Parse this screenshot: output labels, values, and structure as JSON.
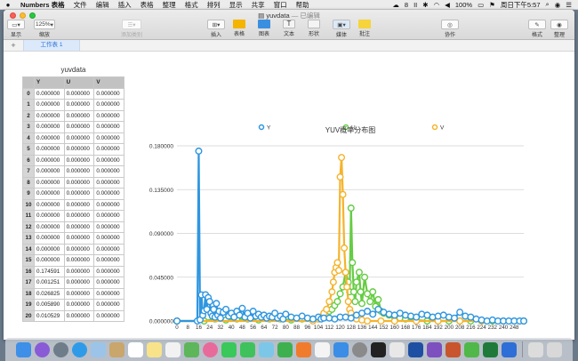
{
  "menubar": {
    "app_name": "Numbers 表格",
    "items": [
      "文件",
      "编辑",
      "插入",
      "表格",
      "整理",
      "格式",
      "排列",
      "显示",
      "共享",
      "窗口",
      "帮助"
    ],
    "status": {
      "battery": "100%",
      "datetime": "周日下午5:57",
      "badge": "8",
      "pause": "II"
    }
  },
  "window": {
    "title": "yuvdata",
    "edited": "— 已编辑"
  },
  "toolbar": {
    "view_label": "显示",
    "zoom_value": "125%",
    "zoom_label": "缩放",
    "add_category_label": "添加类别",
    "insert_label": "插入",
    "table_label": "表格",
    "chart_label": "图表",
    "text_label": "文本",
    "shape_label": "形状",
    "media_label": "媒体",
    "comment_label": "批注",
    "collaborate_label": "协作",
    "format_label": "格式",
    "organize_label": "整理"
  },
  "sheet_tabs": {
    "add": "+",
    "active": "工作表 1"
  },
  "table": {
    "title": "yuvdata",
    "headers": [
      "Y",
      "U",
      "V"
    ],
    "rows": [
      {
        "idx": "0",
        "y": "0.000000",
        "u": "0.000000",
        "v": "0.000000"
      },
      {
        "idx": "1",
        "y": "0.000000",
        "u": "0.000000",
        "v": "0.000000"
      },
      {
        "idx": "2",
        "y": "0.000000",
        "u": "0.000000",
        "v": "0.000000"
      },
      {
        "idx": "3",
        "y": "0.000000",
        "u": "0.000000",
        "v": "0.000000"
      },
      {
        "idx": "4",
        "y": "0.000000",
        "u": "0.000000",
        "v": "0.000000"
      },
      {
        "idx": "5",
        "y": "0.000000",
        "u": "0.000000",
        "v": "0.000000"
      },
      {
        "idx": "6",
        "y": "0.000000",
        "u": "0.000000",
        "v": "0.000000"
      },
      {
        "idx": "7",
        "y": "0.000000",
        "u": "0.000000",
        "v": "0.000000"
      },
      {
        "idx": "8",
        "y": "0.000000",
        "u": "0.000000",
        "v": "0.000000"
      },
      {
        "idx": "9",
        "y": "0.000000",
        "u": "0.000000",
        "v": "0.000000"
      },
      {
        "idx": "10",
        "y": "0.000000",
        "u": "0.000000",
        "v": "0.000000"
      },
      {
        "idx": "11",
        "y": "0.000000",
        "u": "0.000000",
        "v": "0.000000"
      },
      {
        "idx": "12",
        "y": "0.000000",
        "u": "0.000000",
        "v": "0.000000"
      },
      {
        "idx": "13",
        "y": "0.000000",
        "u": "0.000000",
        "v": "0.000000"
      },
      {
        "idx": "14",
        "y": "0.000000",
        "u": "0.000000",
        "v": "0.000000"
      },
      {
        "idx": "15",
        "y": "0.000000",
        "u": "0.000000",
        "v": "0.000000"
      },
      {
        "idx": "16",
        "y": "0.174591",
        "u": "0.000000",
        "v": "0.000000"
      },
      {
        "idx": "17",
        "y": "0.001251",
        "u": "0.000000",
        "v": "0.000000"
      },
      {
        "idx": "18",
        "y": "0.026825",
        "u": "0.000000",
        "v": "0.000000"
      },
      {
        "idx": "19",
        "y": "0.005890",
        "u": "0.000000",
        "v": "0.000000"
      },
      {
        "idx": "20",
        "y": "0.010529",
        "u": "0.000000",
        "v": "0.000000"
      }
    ]
  },
  "chart_data": {
    "type": "line",
    "title": "YUV概率分布图",
    "xlabel": "",
    "ylabel": "",
    "legend_position": "top",
    "grid": true,
    "ylim": [
      0,
      0.18
    ],
    "y_ticks": [
      "0.000000",
      "0.045000",
      "0.090000",
      "0.135000",
      "0.180000"
    ],
    "x_ticks": [
      "0",
      "8",
      "16",
      "24",
      "32",
      "40",
      "48",
      "56",
      "64",
      "72",
      "80",
      "88",
      "96",
      "104",
      "112",
      "120",
      "128",
      "136",
      "144",
      "152",
      "160",
      "168",
      "176",
      "184",
      "192",
      "200",
      "208",
      "216",
      "224",
      "232",
      "240",
      "248"
    ],
    "x_range": [
      0,
      255
    ],
    "series": [
      {
        "name": "Y",
        "color": "#2f96e0",
        "points": [
          [
            0,
            0
          ],
          [
            15,
            0
          ],
          [
            16,
            0.174591
          ],
          [
            17,
            0.001251
          ],
          [
            18,
            0.026825
          ],
          [
            19,
            0.00589
          ],
          [
            20,
            0.010529
          ],
          [
            21,
            0.027
          ],
          [
            22,
            0.012
          ],
          [
            23,
            0.024
          ],
          [
            24,
            0.02
          ],
          [
            25,
            0.008
          ],
          [
            26,
            0.005
          ],
          [
            27,
            0.012
          ],
          [
            28,
            0.004
          ],
          [
            29,
            0.018
          ],
          [
            30,
            0.006
          ],
          [
            31,
            0.01
          ],
          [
            32,
            0.003
          ],
          [
            34,
            0.009
          ],
          [
            36,
            0.012
          ],
          [
            38,
            0.005
          ],
          [
            40,
            0.008
          ],
          [
            42,
            0.004
          ],
          [
            44,
            0.01
          ],
          [
            46,
            0.006
          ],
          [
            48,
            0.013
          ],
          [
            50,
            0.004
          ],
          [
            52,
            0.008
          ],
          [
            54,
            0.003
          ],
          [
            56,
            0.01
          ],
          [
            58,
            0.005
          ],
          [
            60,
            0.007
          ],
          [
            62,
            0.004
          ],
          [
            64,
            0.006
          ],
          [
            66,
            0.003
          ],
          [
            68,
            0.005
          ],
          [
            70,
            0.004
          ],
          [
            72,
            0.008
          ],
          [
            74,
            0.003
          ],
          [
            76,
            0.005
          ],
          [
            78,
            0.002
          ],
          [
            80,
            0.007
          ],
          [
            84,
            0.004
          ],
          [
            88,
            0.003
          ],
          [
            92,
            0.005
          ],
          [
            96,
            0.003
          ],
          [
            100,
            0.002
          ],
          [
            104,
            0.004
          ],
          [
            106,
            0.002
          ],
          [
            108,
            0.003
          ],
          [
            112,
            0.003
          ],
          [
            116,
            0.002
          ],
          [
            120,
            0.004
          ],
          [
            124,
            0.004
          ],
          [
            128,
            0.003
          ],
          [
            132,
            0.006
          ],
          [
            136,
            0.008
          ],
          [
            140,
            0.01
          ],
          [
            144,
            0.007
          ],
          [
            148,
            0.012
          ],
          [
            152,
            0.009
          ],
          [
            156,
            0.007
          ],
          [
            160,
            0.006
          ],
          [
            164,
            0.008
          ],
          [
            168,
            0.006
          ],
          [
            172,
            0.005
          ],
          [
            176,
            0.004
          ],
          [
            180,
            0.007
          ],
          [
            184,
            0.006
          ],
          [
            188,
            0.004
          ],
          [
            192,
            0.005
          ],
          [
            196,
            0.006
          ],
          [
            200,
            0.004
          ],
          [
            204,
            0.003
          ],
          [
            208,
            0.009
          ],
          [
            212,
            0.005
          ],
          [
            216,
            0.004
          ],
          [
            220,
            0.002
          ],
          [
            224,
            0.001
          ],
          [
            228,
            0
          ],
          [
            232,
            0.001
          ],
          [
            236,
            0
          ],
          [
            240,
            0
          ],
          [
            244,
            0
          ],
          [
            248,
            0
          ],
          [
            252,
            0
          ],
          [
            255,
            0
          ]
        ]
      },
      {
        "name": "U",
        "color": "#66cc44",
        "points": [
          [
            0,
            0
          ],
          [
            20,
            0
          ],
          [
            28,
            0.002
          ],
          [
            36,
            0.001
          ],
          [
            44,
            0.002
          ],
          [
            52,
            0.002
          ],
          [
            60,
            0.001
          ],
          [
            68,
            0.002
          ],
          [
            76,
            0.002
          ],
          [
            84,
            0.001
          ],
          [
            92,
            0.002
          ],
          [
            100,
            0.002
          ],
          [
            104,
            0.002
          ],
          [
            108,
            0.004
          ],
          [
            110,
            0.006
          ],
          [
            112,
            0.01
          ],
          [
            114,
            0.012
          ],
          [
            116,
            0.016
          ],
          [
            118,
            0.02
          ],
          [
            120,
            0.028
          ],
          [
            122,
            0.035
          ],
          [
            124,
            0.05
          ],
          [
            126,
            0.04
          ],
          [
            127,
            0.03
          ],
          [
            128,
            0.116
          ],
          [
            129,
            0.06
          ],
          [
            130,
            0.03
          ],
          [
            131,
            0.02
          ],
          [
            132,
            0.04
          ],
          [
            134,
            0.05
          ],
          [
            135,
            0.03
          ],
          [
            136,
            0.018
          ],
          [
            138,
            0.045
          ],
          [
            140,
            0.028
          ],
          [
            142,
            0.02
          ],
          [
            144,
            0.03
          ],
          [
            146,
            0.015
          ],
          [
            148,
            0.022
          ],
          [
            150,
            0.01
          ],
          [
            152,
            0.008
          ],
          [
            156,
            0.006
          ],
          [
            160,
            0.004
          ],
          [
            164,
            0.003
          ],
          [
            168,
            0.002
          ],
          [
            176,
            0.001
          ],
          [
            184,
            0
          ],
          [
            192,
            0
          ],
          [
            200,
            0
          ],
          [
            208,
            0
          ],
          [
            216,
            0
          ],
          [
            224,
            0
          ],
          [
            232,
            0
          ],
          [
            240,
            0
          ],
          [
            248,
            0
          ],
          [
            255,
            0
          ]
        ]
      },
      {
        "name": "V",
        "color": "#f5b32c",
        "points": [
          [
            0,
            0
          ],
          [
            100,
            0
          ],
          [
            104,
            0.002
          ],
          [
            106,
            0.004
          ],
          [
            108,
            0.008
          ],
          [
            110,
            0.012
          ],
          [
            112,
            0.02
          ],
          [
            114,
            0.03
          ],
          [
            115,
            0.04
          ],
          [
            116,
            0.05
          ],
          [
            117,
            0.055
          ],
          [
            118,
            0.06
          ],
          [
            119,
            0.052
          ],
          [
            120,
            0.148
          ],
          [
            121,
            0.168
          ],
          [
            122,
            0.13
          ],
          [
            123,
            0.075
          ],
          [
            124,
            0.05
          ],
          [
            125,
            0.035
          ],
          [
            126,
            0.02
          ],
          [
            127,
            0.012
          ],
          [
            128,
            0.008
          ],
          [
            130,
            0.004
          ],
          [
            132,
            0.002
          ],
          [
            136,
            0.001
          ],
          [
            140,
            0
          ],
          [
            150,
            0
          ],
          [
            160,
            0
          ],
          [
            176,
            0
          ],
          [
            192,
            0
          ],
          [
            208,
            0
          ],
          [
            224,
            0
          ],
          [
            240,
            0
          ],
          [
            255,
            0
          ]
        ]
      }
    ]
  }
}
